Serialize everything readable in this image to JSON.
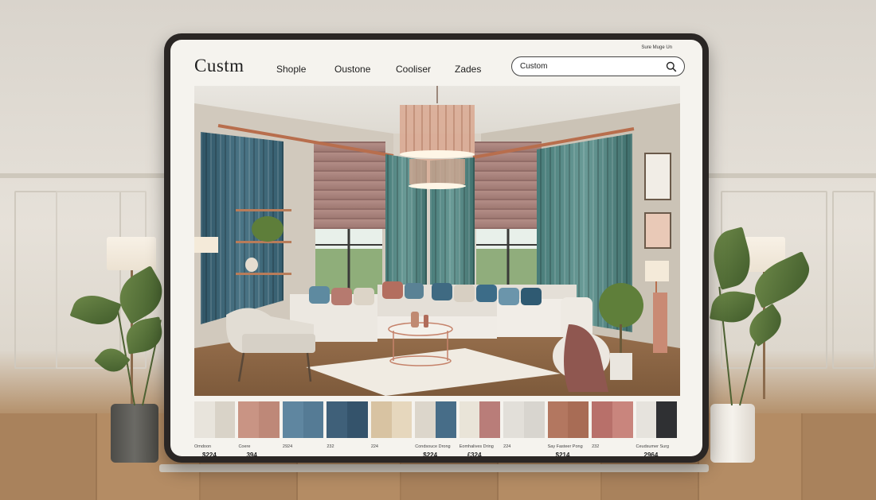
{
  "header": {
    "logo": "Custm",
    "nav": [
      "Shople",
      "Oustone",
      "Cooliser",
      "Zades"
    ],
    "signin": "Sure Muge Un"
  },
  "search": {
    "value": "Custom",
    "icon": "search-icon"
  },
  "swatches": [
    {
      "name": "Omdoon",
      "price": "$224",
      "colors": [
        "#e8e4dc",
        "#d9d3c8"
      ]
    },
    {
      "name": "Coere",
      "price": "394",
      "colors": [
        "#c99484",
        "#be8878"
      ]
    },
    {
      "name": "2924",
      "price": "",
      "colors": [
        "#5f86a0",
        "#557b95"
      ]
    },
    {
      "name": "232",
      "price": "",
      "colors": [
        "#3f6079",
        "#34536b"
      ]
    },
    {
      "name": "224",
      "price": "",
      "colors": [
        "#d8c3a2",
        "#e6d7bd"
      ]
    },
    {
      "name": "Condsouce Drong",
      "price": "$224",
      "colors": [
        "#dcd6cb",
        "#476d88"
      ]
    },
    {
      "name": "Eomhalives Dring",
      "price": "£324",
      "colors": [
        "#e9e4d8",
        "#b97d79"
      ]
    },
    {
      "name": "224",
      "price": "",
      "colors": [
        "#e2dfd9",
        "#d8d5cf"
      ]
    },
    {
      "name": "Say Fasteer Pong",
      "price": "$214",
      "colors": [
        "#b37760",
        "#a86c55"
      ]
    },
    {
      "name": "232",
      "price": "",
      "colors": [
        "#b8706a",
        "#c9857d"
      ]
    },
    {
      "name": "Ceudsumer Surg",
      "price": "2964",
      "colors": [
        "#e6e3dd",
        "#2f3033"
      ]
    }
  ]
}
